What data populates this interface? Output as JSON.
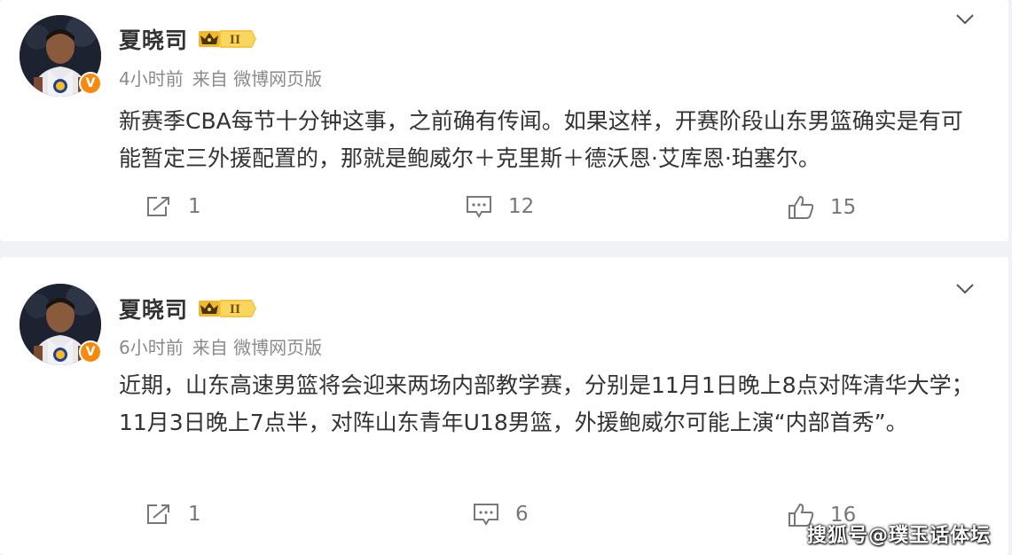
{
  "posts": [
    {
      "user": {
        "name": "夏晓司",
        "level_icon": "level-II-crown-badge",
        "verified_icon": "verified-v-badge"
      },
      "meta": {
        "time": "4小时前",
        "source": "来自 微博网页版"
      },
      "text": "新赛季CBA每节十分钟这事，之前确有传闻。如果这样，开赛阶段山东男篮确实是有可能暂定三外援配置的，那就是鲍威尔＋克里斯＋德沃恩·艾库恩·珀塞尔。",
      "actions": {
        "repost": "1",
        "comment": "12",
        "like": "15"
      }
    },
    {
      "user": {
        "name": "夏晓司",
        "level_icon": "level-II-crown-badge",
        "verified_icon": "verified-v-badge"
      },
      "meta": {
        "time": "6小时前",
        "source": "来自 微博网页版"
      },
      "text": "近期，山东高速男篮将会迎来两场内部教学赛，分别是11月1日晚上8点对阵清华大学；11月3日晚上7点半，对阵山东青年U18男篮，外援鲍威尔可能上演“内部首秀”。",
      "actions": {
        "repost": "1",
        "comment": "6",
        "like": "16"
      }
    }
  ],
  "verified_label": "V",
  "level_label": "II",
  "watermark": "搜狐号@璞玉话体坛",
  "colors": {
    "accent": "#f78a0e",
    "background": "#f1f2f5",
    "card": "#ffffff",
    "meta_text": "#8a8a8a"
  }
}
